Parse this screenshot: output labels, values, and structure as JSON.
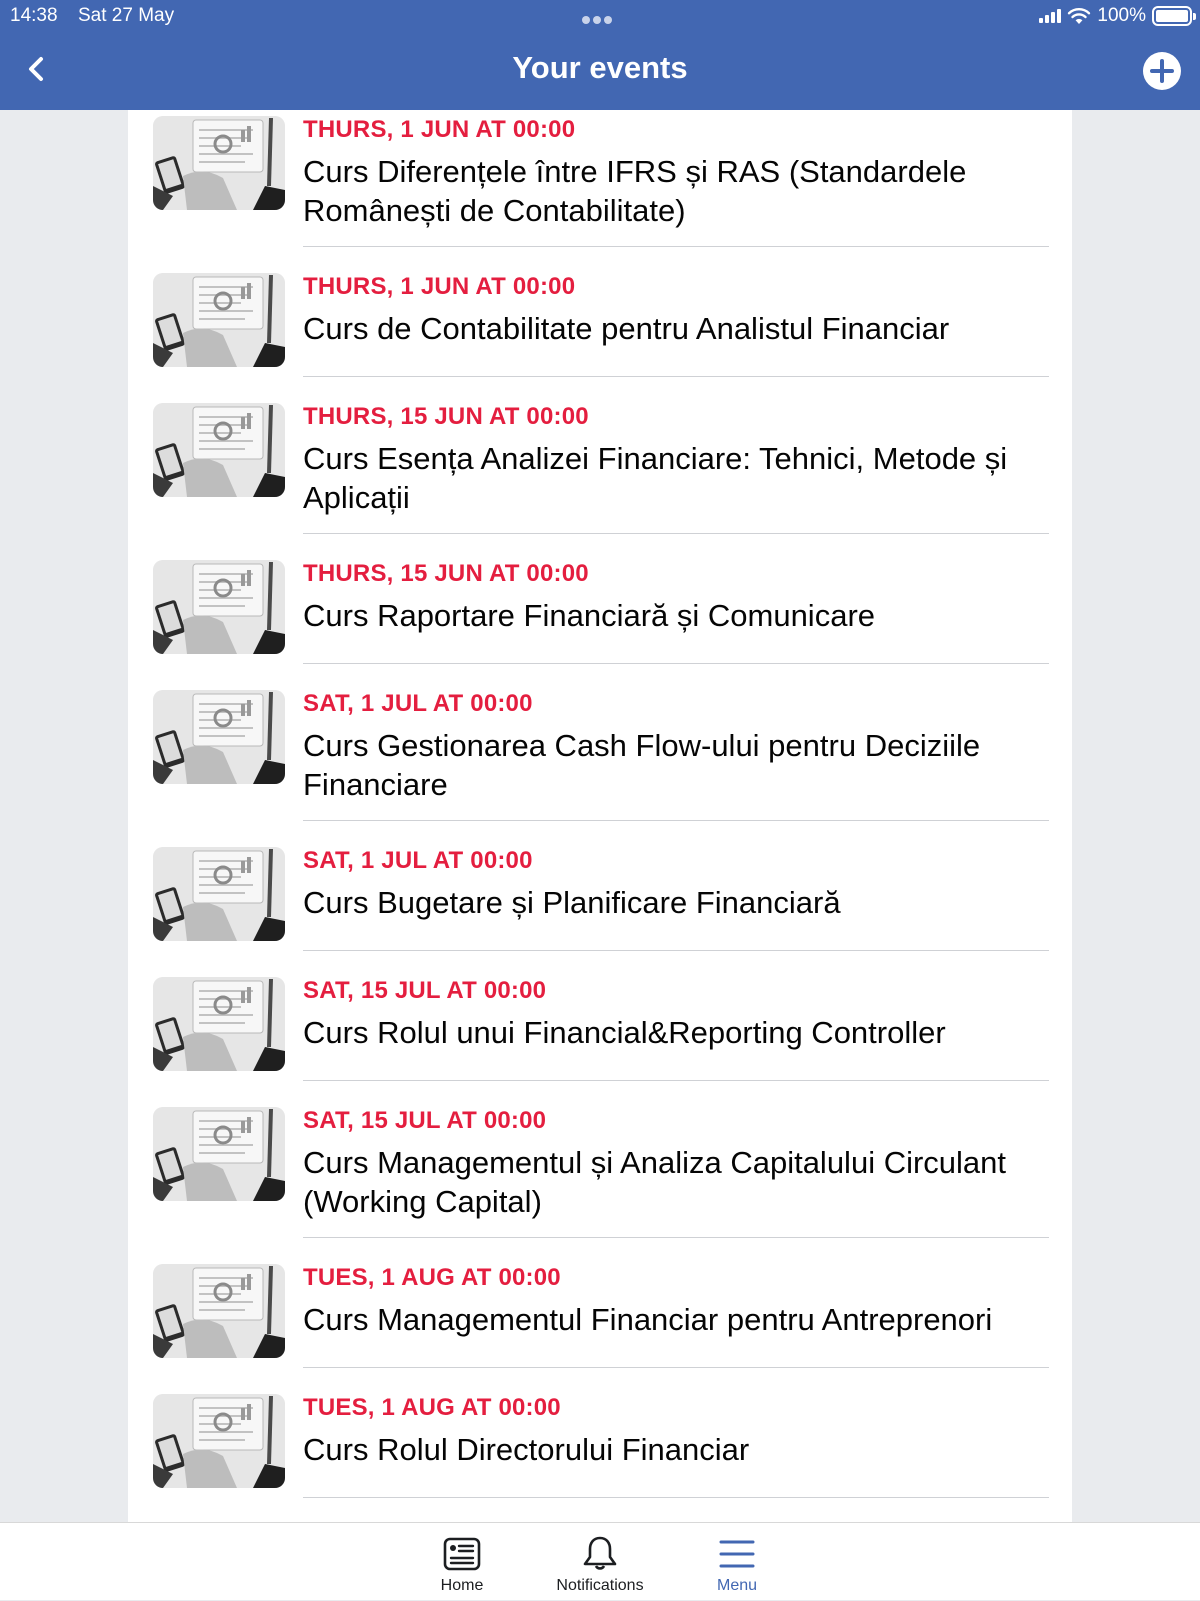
{
  "status_bar": {
    "time": "14:38",
    "date": "Sat 27 May",
    "battery": "100%"
  },
  "header": {
    "title": "Your events",
    "back_icon": "chevron-left-icon",
    "add_icon": "plus-circle-icon",
    "bg_color": "#4267b2"
  },
  "events": [
    {
      "date": "THURS, 1 JUN AT 00:00",
      "title": "Curs Diferențele între IFRS și RAS (Standardele Românești de Contabilitate)"
    },
    {
      "date": "THURS, 1 JUN AT 00:00",
      "title": "Curs de Contabilitate pentru Analistul Financiar"
    },
    {
      "date": "THURS, 15 JUN AT 00:00",
      "title": "Curs Esența Analizei Financiare: Tehnici, Metode și Aplicații"
    },
    {
      "date": "THURS, 15 JUN AT 00:00",
      "title": "Curs Raportare Financiară și Comunicare"
    },
    {
      "date": "SAT, 1 JUL AT 00:00",
      "title": "Curs Gestionarea Cash Flow-ului pentru Deciziile Financiare"
    },
    {
      "date": "SAT, 1 JUL AT 00:00",
      "title": "Curs Bugetare și Planificare Financiară"
    },
    {
      "date": "SAT, 15 JUL AT 00:00",
      "title": "Curs Rolul unui Financial&Reporting Controller"
    },
    {
      "date": "SAT, 15 JUL AT 00:00",
      "title": "Curs Managementul și Analiza Capitalului Circulant (Working Capital)"
    },
    {
      "date": "TUES, 1 AUG AT 00:00",
      "title": "Curs Managementul Financiar pentru Antreprenori"
    },
    {
      "date": "TUES, 1 AUG AT 00:00",
      "title": "Curs Rolul Directorului Financiar"
    }
  ],
  "tabbar": {
    "tabs": [
      {
        "label": "Home",
        "icon": "news-feed-icon"
      },
      {
        "label": "Notifications",
        "icon": "bell-icon"
      },
      {
        "label": "Menu",
        "icon": "menu-icon",
        "active": true
      }
    ]
  },
  "colors": {
    "accent": "#4267b2",
    "date_red": "#e41e3f"
  }
}
